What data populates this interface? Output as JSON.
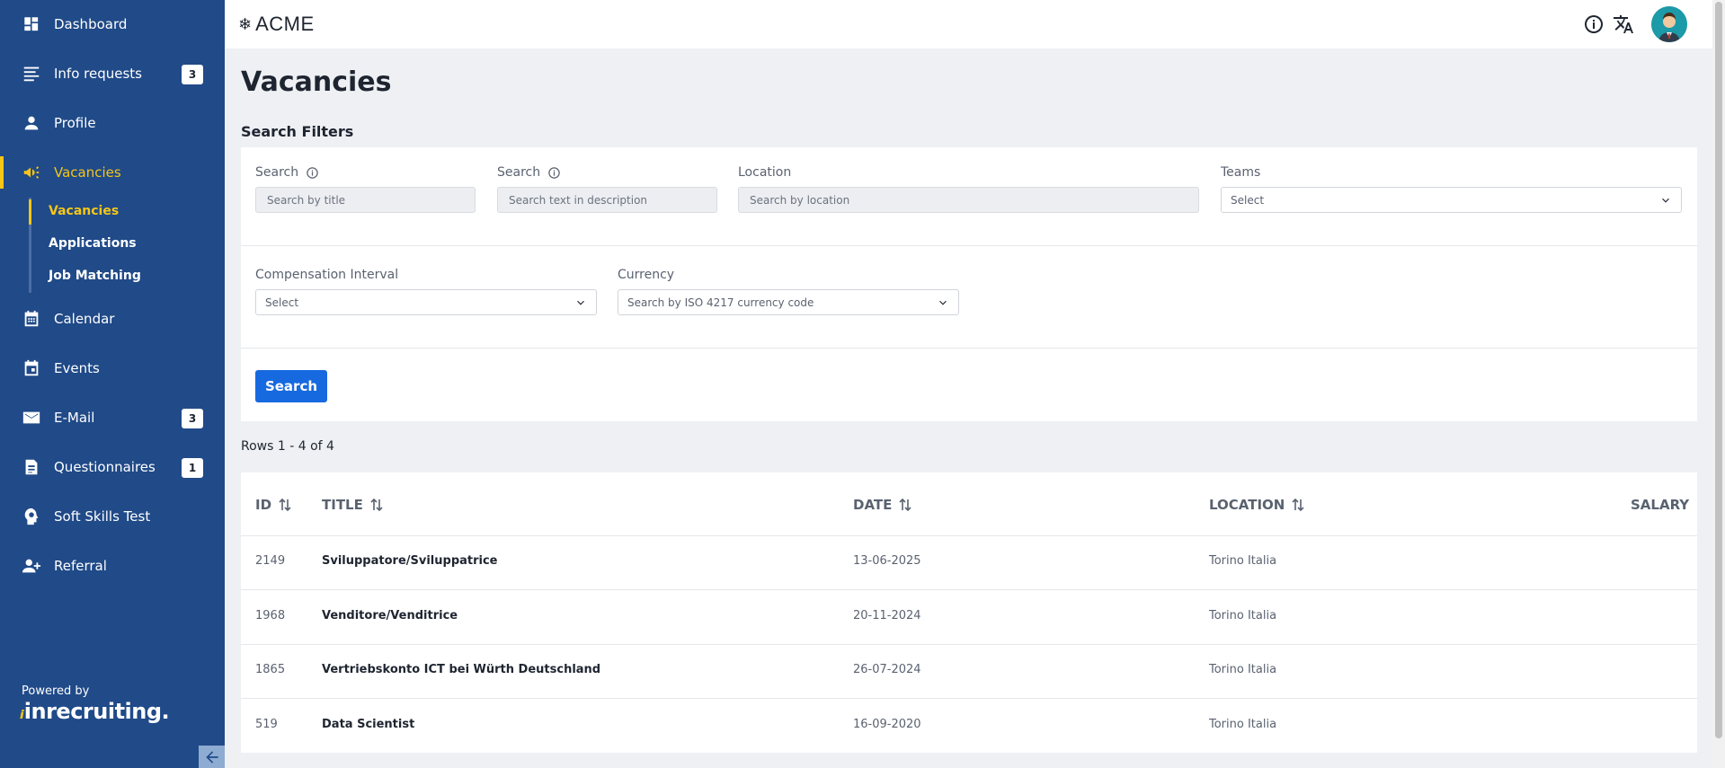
{
  "sidebar": {
    "items": [
      {
        "label": "Dashboard"
      },
      {
        "label": "Info requests",
        "badge": "3"
      },
      {
        "label": "Profile"
      },
      {
        "label": "Vacancies"
      },
      {
        "label": "Calendar"
      },
      {
        "label": "Events"
      },
      {
        "label": "E-Mail",
        "badge": "3"
      },
      {
        "label": "Questionnaires",
        "badge": "1"
      },
      {
        "label": "Soft Skills Test"
      },
      {
        "label": "Referral"
      }
    ],
    "subitems": [
      {
        "label": "Vacancies"
      },
      {
        "label": "Applications"
      },
      {
        "label": "Job Matching"
      }
    ],
    "powered_by": "Powered by",
    "brand": "inrecruiting."
  },
  "header": {
    "logo_text": "ACME"
  },
  "main": {
    "title": "Vacancies",
    "filters_title": "Search Filters",
    "filters": {
      "search_title_label": "Search",
      "search_title_placeholder": "Search by title",
      "search_desc_label": "Search",
      "search_desc_placeholder": "Search text in description",
      "location_label": "Location",
      "location_placeholder": "Search by location",
      "teams_label": "Teams",
      "teams_value": "Select",
      "compensation_label": "Compensation Interval",
      "compensation_value": "Select",
      "currency_label": "Currency",
      "currency_value": "Search by ISO 4217 currency code",
      "search_button": "Search"
    },
    "rows_info": "Rows 1 - 4 of 4",
    "table": {
      "columns": [
        "ID",
        "TITLE",
        "DATE",
        "LOCATION",
        "SALARY"
      ],
      "rows": [
        {
          "id": "2149",
          "title": "Sviluppatore/Sviluppatrice",
          "date": "13-06-2025",
          "location": "Torino Italia",
          "salary": ""
        },
        {
          "id": "1968",
          "title": "Venditore/Venditrice",
          "date": "20-11-2024",
          "location": "Torino Italia",
          "salary": ""
        },
        {
          "id": "1865",
          "title": "Vertriebskonto ICT bei Würth Deutschland",
          "date": "26-07-2024",
          "location": "Torino Italia",
          "salary": ""
        },
        {
          "id": "519",
          "title": "Data Scientist",
          "date": "16-09-2020",
          "location": "Torino Italia",
          "salary": ""
        }
      ]
    }
  },
  "colors": {
    "sidebar_bg": "#204a88",
    "accent_yellow": "#f5c518",
    "primary_button": "#1769e0",
    "page_bg": "#eef0f3"
  },
  "icons": {
    "dashboard": "dashboard-icon",
    "info_requests": "list-icon",
    "profile": "person-icon",
    "vacancies": "megaphone-icon",
    "calendar": "calendar-icon",
    "events": "event-icon",
    "email": "mail-icon",
    "questionnaires": "document-icon",
    "soft_skills": "head-gear-icon",
    "referral": "person-add-icon",
    "info": "info-icon",
    "translate": "translate-icon",
    "collapse": "arrow-left-icon"
  }
}
